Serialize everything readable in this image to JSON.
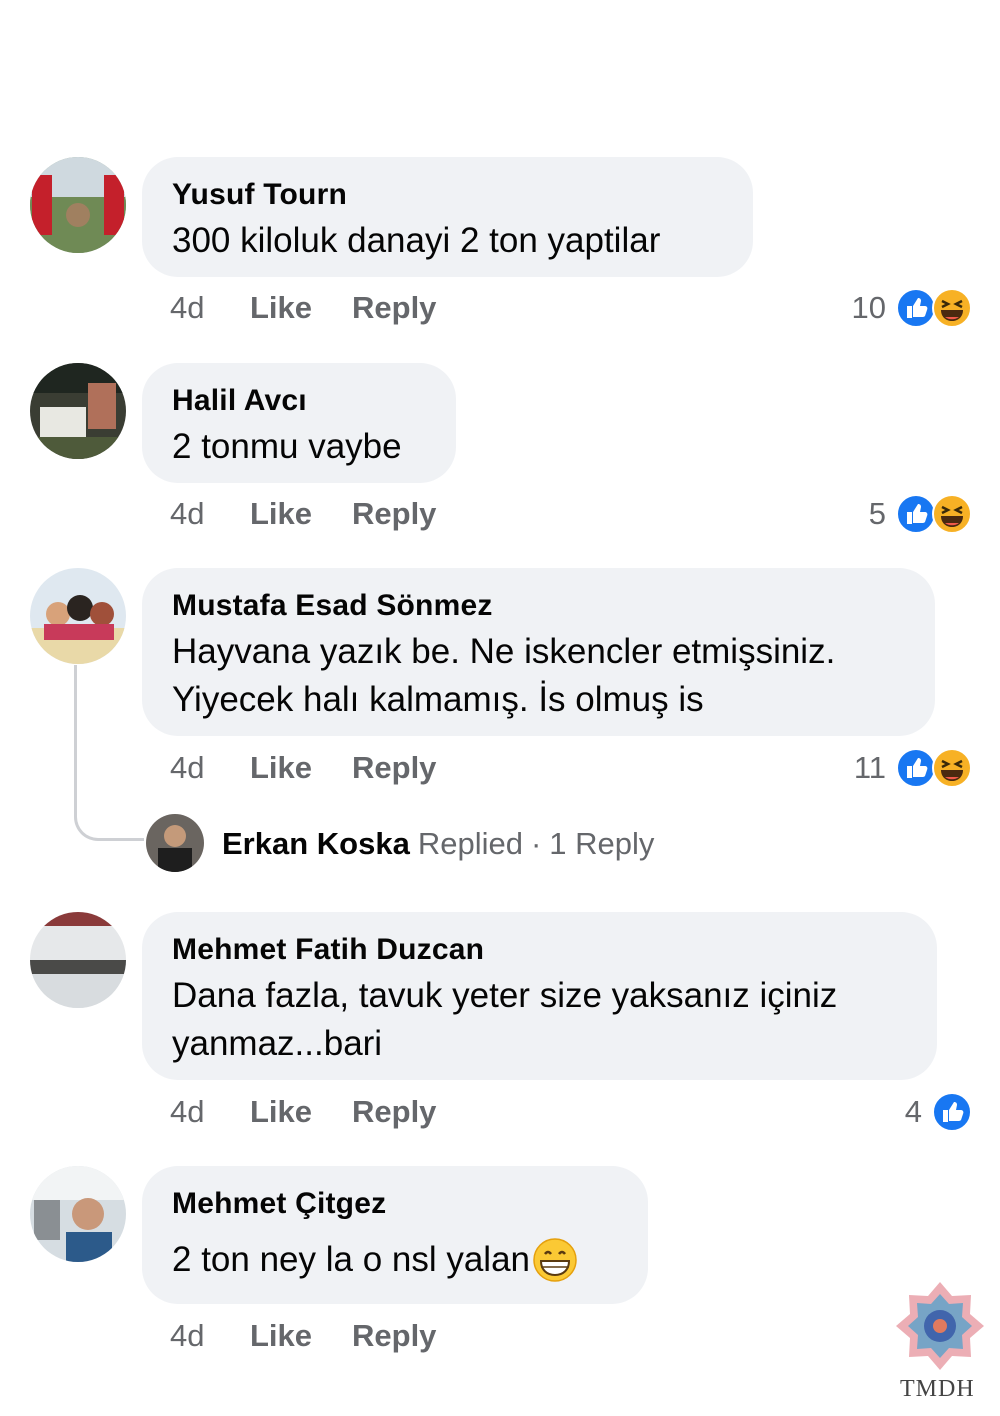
{
  "comments": [
    {
      "name": "Yusuf Tourn",
      "text": "300 kiloluk danayi 2 ton yaptilar",
      "time": "4d",
      "like": "Like",
      "reply": "Reply",
      "reaction_count": "10",
      "reactions": [
        "like-icon",
        "haha-icon"
      ]
    },
    {
      "name": "Halil Avcı",
      "text": "2 tonmu vaybe",
      "time": "4d",
      "like": "Like",
      "reply": "Reply",
      "reaction_count": "5",
      "reactions": [
        "like-icon",
        "haha-icon"
      ]
    },
    {
      "name": "Mustafa Esad Sönmez",
      "text_line1": "Hayvana yazık be. Ne iskencler etmişsiniz.",
      "text_line2": "Yiyecek halı kalmamış. İs olmuş is",
      "time": "4d",
      "like": "Like",
      "reply": "Reply",
      "reaction_count": "11",
      "reactions": [
        "like-icon",
        "haha-icon"
      ],
      "replies_preview": {
        "name": "Erkan Koska",
        "action": "Replied",
        "separator": "·",
        "count_label": "1 Reply"
      }
    },
    {
      "name": "Mehmet Fatih Duzcan",
      "text_line1": "Dana fazla, tavuk yeter size yaksanız içiniz",
      "text_line2": "yanmaz...bari",
      "time": "4d",
      "like": "Like",
      "reply": "Reply",
      "reaction_count": "4",
      "reactions": [
        "like-icon"
      ]
    },
    {
      "name": "Mehmet Çitgez",
      "text": "2 ton ney la o nsl yalan",
      "emoji": "grinning-face-icon",
      "time": "4d",
      "like": "Like",
      "reply": "Reply"
    }
  ],
  "watermark": {
    "text": "TMDH"
  },
  "colors": {
    "bubble": "#f0f2f5",
    "meta": "#65676b",
    "like_blue": "#1877f2",
    "haha_yellow": "#f7b125"
  }
}
